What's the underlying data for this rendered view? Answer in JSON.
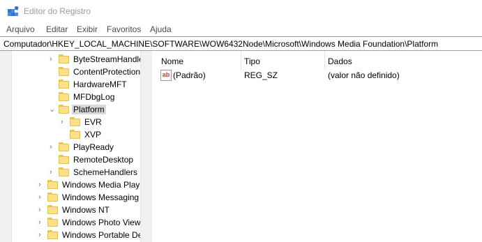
{
  "window": {
    "title": "Editor do Registro",
    "icon": "registry-editor-icon"
  },
  "menu": [
    "Arquivo",
    "Editar",
    "Exibir",
    "Favoritos",
    "Ajuda"
  ],
  "address": "Computador\\HKEY_LOCAL_MACHINE\\SOFTWARE\\WOW6432Node\\Microsoft\\Windows Media Foundation\\Platform",
  "tree": {
    "items": [
      {
        "label": "ByteStreamHandlers",
        "expander": "collapsed"
      },
      {
        "label": "ContentProtectionSystems",
        "expander": "none"
      },
      {
        "label": "HardwareMFT",
        "expander": "none"
      },
      {
        "label": "MFDbgLog",
        "expander": "none"
      },
      {
        "label": "Platform",
        "expander": "expanded",
        "selected": true
      },
      {
        "label": "EVR",
        "expander": "collapsed"
      },
      {
        "label": "XVP",
        "expander": "none"
      },
      {
        "label": "PlayReady",
        "expander": "collapsed"
      },
      {
        "label": "RemoteDesktop",
        "expander": "none"
      },
      {
        "label": "SchemeHandlers",
        "expander": "collapsed"
      },
      {
        "label": "Windows Media Player",
        "expander": "collapsed"
      },
      {
        "label": "Windows Messaging Subsystem",
        "expander": "collapsed"
      },
      {
        "label": "Windows NT",
        "expander": "collapsed"
      },
      {
        "label": "Windows Photo Viewer",
        "expander": "collapsed"
      },
      {
        "label": "Windows Portable Devices",
        "expander": "collapsed"
      }
    ]
  },
  "list": {
    "columns": [
      "Nome",
      "Tipo",
      "Dados"
    ],
    "rows": [
      {
        "icon": "ab",
        "name": "(Padrão)",
        "type": "REG_SZ",
        "data": "(valor não definido)"
      }
    ]
  },
  "colors": {
    "selection": "#d9d9d9",
    "folder": "#ffe08a",
    "scrollbar": "#f0f0f0"
  }
}
